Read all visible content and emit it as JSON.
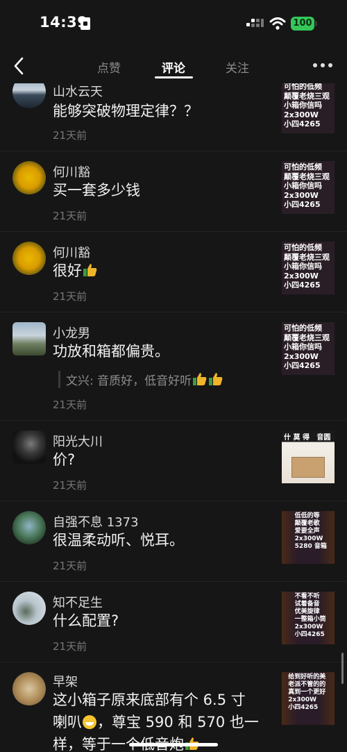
{
  "status_bar": {
    "time": "14:39",
    "battery": "100"
  },
  "nav": {
    "tabs": [
      {
        "label": "点赞"
      },
      {
        "label": "评论"
      },
      {
        "label": "关注"
      }
    ],
    "active_tab": "评论"
  },
  "comments": [
    {
      "name": "山水云天",
      "content": "能够突破物理定律？？",
      "time": "21天前",
      "thumb_text": "可怕的低频\n颠覆老烧三观\n小箱你信吗\n2x300W\n小四4265"
    },
    {
      "name": "何川豁",
      "content": "买一套多少钱",
      "time": "21天前",
      "thumb_text": "可怕的低频\n颠覆老烧三观\n小箱你信吗\n2x300W\n小四4265"
    },
    {
      "name": "何川豁",
      "content": "很好",
      "time": "21天前",
      "thumb_text": "可怕的低频\n颠覆老烧三观\n小箱你信吗\n2x300W\n小四4265"
    },
    {
      "name": "小龙男",
      "content": "功放和箱都偏贵。",
      "reply": "文兴: 音质好，低音好听",
      "time": "21天前",
      "thumb_text": "可怕的低频\n颠覆老烧三观\n小箱你信吗\n2x300W\n小四4265"
    },
    {
      "name": "阳光大川",
      "content": "价?",
      "time": "21天前",
      "thumb_text": "什 莫 得   音圆"
    },
    {
      "name": "自强不息 1373",
      "content": "很温柔动听、悦耳。",
      "time": "21天前",
      "thumb_text": "     低低的等\n     颠覆老歌\n     爱要全声\n     2x300W\n     5280 音箱"
    },
    {
      "name": "知不足生",
      "content": "什么配置?",
      "time": "21天前",
      "thumb_text": "     不看不听\n     试着备音\n     优美旋律\n     一整箱小筒\n     2x300W\n     小四4265"
    },
    {
      "name": "早架",
      "content_line1": "这小箱子原来底部有个 6.5 寸",
      "content_line2a": "喇叭",
      "content_line2b": "，尊宝 590 和 570 也一",
      "content_line3": "样，等于一个低音炮",
      "thumb_text": "  给到好听的美\n  老派不管的的\n  真到一个更好\n  2x300W\n  小四4265"
    }
  ],
  "colors": {
    "background": "#161616",
    "battery": "#35c759",
    "thumb_emoji": "#f0b429"
  },
  "icons": [
    "back-icon",
    "more-icon",
    "signal-icon",
    "wifi-icon",
    "battery-icon",
    "sim-icon"
  ]
}
